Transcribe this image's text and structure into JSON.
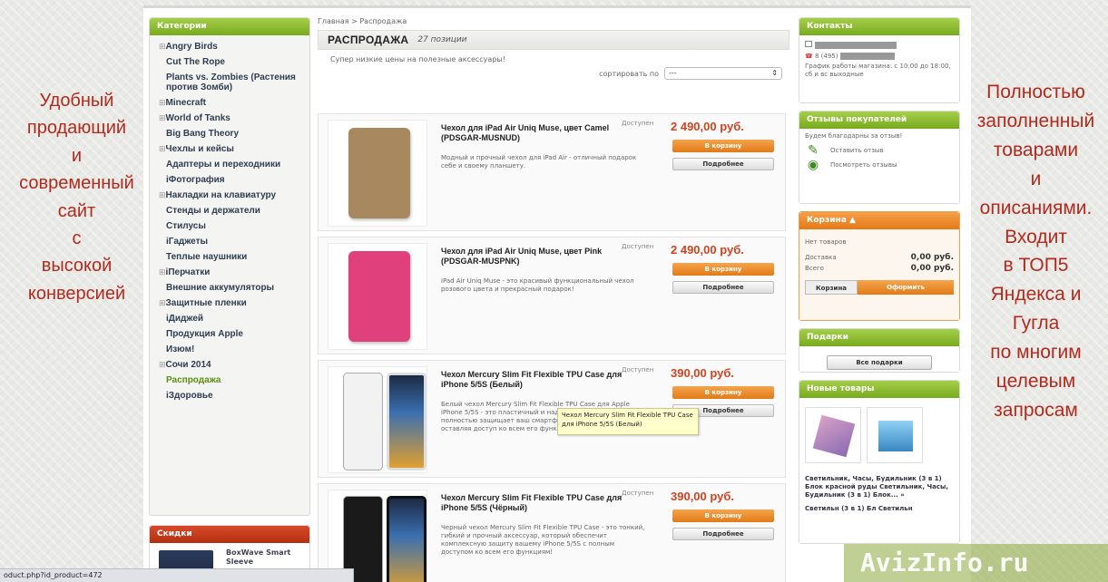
{
  "caption_left": [
    "Удобный",
    "продающий",
    "и",
    "современный",
    "сайт",
    "с",
    "высокой",
    "конверсией"
  ],
  "caption_right": [
    "Полностью",
    "заполненный",
    "товарами",
    "и",
    "описаниями.",
    "Входит",
    "в ТОП5",
    "Яндекса и",
    "Гугла",
    "по многим",
    "целевым",
    "запросам"
  ],
  "categories": {
    "header": "Категории",
    "items": [
      {
        "label": "Angry Birds",
        "expandable": true
      },
      {
        "label": "Cut The Rope",
        "expandable": false
      },
      {
        "label": "Plants vs. Zombies (Растения против Зомби)",
        "expandable": false
      },
      {
        "label": "Minecraft",
        "expandable": true
      },
      {
        "label": "World of Tanks",
        "expandable": true
      },
      {
        "label": "Big Bang Theory",
        "expandable": false
      },
      {
        "label": "Чехлы и кейсы",
        "expandable": true
      },
      {
        "label": "Адаптеры и переходники",
        "expandable": false
      },
      {
        "label": "iФотография",
        "expandable": false
      },
      {
        "label": "Накладки на клавиатуру",
        "expandable": true
      },
      {
        "label": "Стенды и держатели",
        "expandable": false
      },
      {
        "label": "Стилусы",
        "expandable": false
      },
      {
        "label": "iГаджеты",
        "expandable": false
      },
      {
        "label": "Теплые наушники",
        "expandable": false
      },
      {
        "label": "iПерчатки",
        "expandable": true
      },
      {
        "label": "Внешние аккумуляторы",
        "expandable": false
      },
      {
        "label": "Защитные пленки",
        "expandable": true
      },
      {
        "label": "iДиджей",
        "expandable": false
      },
      {
        "label": "Продукция Apple",
        "expandable": false
      },
      {
        "label": "Изюм!",
        "expandable": false
      },
      {
        "label": "Сочи 2014",
        "expandable": true
      },
      {
        "label": "Распродажа",
        "expandable": false,
        "active": true
      },
      {
        "label": "iЗдоровье",
        "expandable": false
      }
    ]
  },
  "sale_box": {
    "header": "Скидки",
    "text": "BoxWave Smart Sleeve"
  },
  "breadcrumb": "Главная > Распродажа",
  "page_title": "РАСПРОДАЖА",
  "items_count": "27 позиции",
  "subtitle": "Супер низкие цены на полезные аксессуары!",
  "sort": {
    "label": "сортировать по",
    "value": "---"
  },
  "products": [
    {
      "name": "Чехол для iPad Air Uniq Muse, цвет Camel (PDSGAR-MUSNUD)",
      "stock": "Доступен",
      "price": "2 490,00 руб.",
      "desc": "Модный и прочный чехол для iPad Air - отличный подарок себе и своему планшету.",
      "cart": "В корзину",
      "more": "Подробнее",
      "color": "#a8895f"
    },
    {
      "name": "Чехол для iPad Air Uniq Muse, цвет Pink (PDSGAR-MUSPNK)",
      "stock": "Доступен",
      "price": "2 490,00 руб.",
      "desc": "iPad Air Uniq Muse - это красивый функциональный чехол розового цвета и прекрасный подарок!",
      "cart": "В корзину",
      "more": "Подробнее",
      "color": "#e0407c"
    },
    {
      "name": "Чехол Mercury Slim Fit Flexible TPU Case для iPhone 5/5S (Белый)",
      "stock": "Доступен",
      "price": "390,00 руб.",
      "desc": "Белый чехол Mercury Slim Fit Flexible TPU Case для Apple iPhone 5/5S - это пластичный и надежный аксессуар, полностью защищает ваш смартфон от повреждений, оставляя доступ ко всем его функциям!",
      "cart": "В корзину",
      "more": "Подробнее",
      "color": "#f2f2f2"
    },
    {
      "name": "Чехол Mercury Slim Fit Flexible TPU Case для iPhone 5/5S (Чёрный)",
      "stock": "Доступен",
      "price": "390,00 руб.",
      "desc": "Черный чехол Mercury Slim Fit Flexible TPU Case - это тонкий, гибкий и прочный аксессуар, который обеспечит комплексную защиту вашему iPhone 5/5S с полным доступом ко всем его функциям!",
      "cart": "В корзину",
      "more": "Подробнее",
      "color": "#1a1a1a"
    }
  ],
  "tooltip": "Чехол Mercury Slim Fit Flexible TPU Case для iPhone 5/5S (Белый)",
  "contacts": {
    "header": "Контакты",
    "phone_prefix": "8 (495)",
    "hours": "График работы магазина: с 10:00 до 18:00, сб и вс выходные"
  },
  "reviews": {
    "header": "Отзывы покупателей",
    "thanks": "Будем благодарны за отзыв!",
    "leave": "Оставить отзыв",
    "view": "Посмотреть отзывы"
  },
  "cart": {
    "header": "Корзина ▲",
    "empty": "Нет товаров",
    "delivery_label": "Доставка",
    "delivery_value": "0,00 руб.",
    "total_label": "Всего",
    "total_value": "0,00 руб.",
    "cart_btn": "Корзина",
    "checkout_btn": "Оформить"
  },
  "gifts": {
    "header": "Подарки",
    "button": "Все подарки"
  },
  "new_items": {
    "header": "Новые товары",
    "text1": "Светильник, Часы, Будильник (3 в 1) Блок красной руды Светильник, Часы, Будильник (3 в 1) Блок... »",
    "text2": "Светильн (3 в 1) Бл Светильн"
  },
  "status_url": "oduct.php?id_product=472",
  "watermark": "AvizInfo.ru"
}
